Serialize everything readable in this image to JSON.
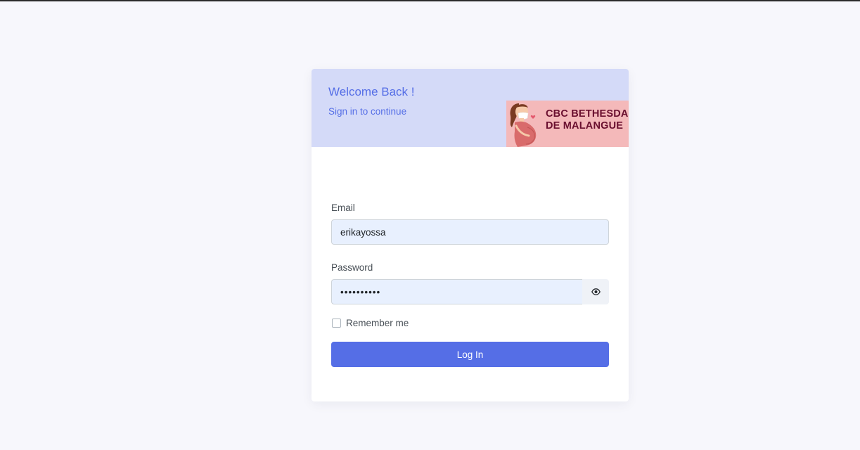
{
  "header": {
    "title": "Welcome Back !",
    "subtitle": "Sign in to continue",
    "brand_line1": "CBC BETHESDA",
    "brand_line2": "DE MALANGUE"
  },
  "form": {
    "email_label": "Email",
    "email_value": "erikayossa",
    "password_label": "Password",
    "password_value": "••••••••••",
    "toggle_icon": "eye-icon",
    "remember_label": "Remember me",
    "remember_checked": false,
    "login_label": "Log In"
  },
  "colors": {
    "primary": "#556ee6",
    "header_bg": "#d4daf8",
    "input_bg": "#e8f0fe",
    "brand_bg": "#f4b9ba",
    "brand_text": "#6a0f2f"
  }
}
